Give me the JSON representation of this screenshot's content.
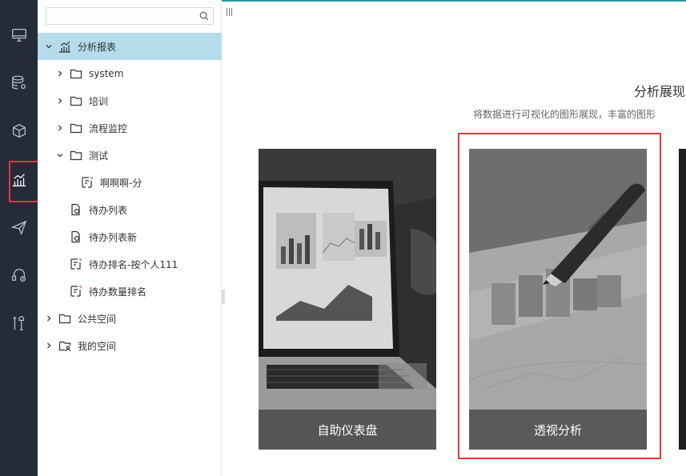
{
  "rail": {
    "items": [
      {
        "icon": "monitor-icon"
      },
      {
        "icon": "database-settings-icon"
      },
      {
        "icon": "cube-icon"
      },
      {
        "icon": "bar-chart-icon",
        "active": true
      },
      {
        "icon": "paper-plane-icon"
      },
      {
        "icon": "headset-user-icon"
      },
      {
        "icon": "tools-icon"
      }
    ]
  },
  "tree": {
    "search": {
      "placeholder": "",
      "value": ""
    },
    "items": [
      {
        "label": "分析报表",
        "type": "analysis-root",
        "expanded": true
      },
      {
        "label": "system",
        "type": "folder"
      },
      {
        "label": "培训",
        "type": "folder"
      },
      {
        "label": "流程监控",
        "type": "folder"
      },
      {
        "label": "测试",
        "type": "folder",
        "expanded": true
      },
      {
        "label": "啊啊啊-分",
        "type": "report"
      },
      {
        "label": "待办列表",
        "type": "doc"
      },
      {
        "label": "待办列表新",
        "type": "doc"
      },
      {
        "label": "待办排名-按个人111",
        "type": "report"
      },
      {
        "label": "待办数量排名",
        "type": "report"
      },
      {
        "label": "公共空间",
        "type": "folder"
      },
      {
        "label": "我的空间",
        "type": "user-folder"
      }
    ]
  },
  "main": {
    "title": "分析展现",
    "subtitle": "将数据进行可视化的图形展现，丰富的图形"
  },
  "cards": [
    {
      "label": "自助仪表盘"
    },
    {
      "label": "透视分析"
    }
  ],
  "colors": {
    "rail_bg": "#262b3a",
    "selected_row": "#b4dcea",
    "highlight": "#e0383e",
    "accent_line": "#2d9aa8"
  }
}
